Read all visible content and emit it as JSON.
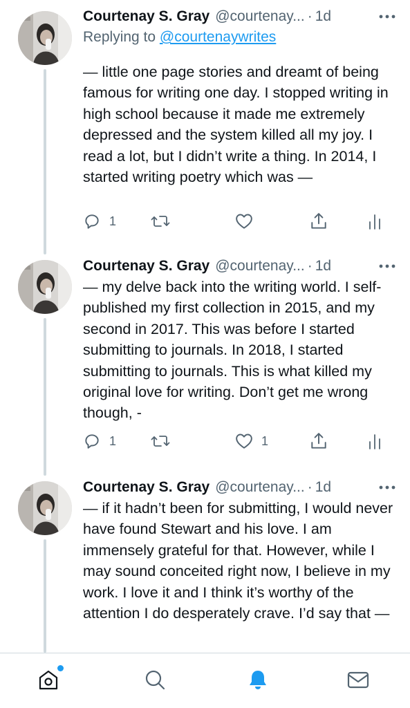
{
  "tweets": [
    {
      "name": "Courtenay S. Gray",
      "handle": "@courtenay...",
      "dot": "·",
      "time": "1d",
      "reply_prefix": "Replying to",
      "reply_handle": "@courtenaywrites",
      "text": "— little one page stories and dreamt of being famous for writing one day. I stopped writing in high school because it made me extremely depressed and the system killed all my joy. I read a lot, but I didn’t write a thing. In 2014, I started writing poetry which was —",
      "reply_count": "1",
      "retweet_count": "",
      "like_count": ""
    },
    {
      "name": "Courtenay S. Gray",
      "handle": "@courtenay...",
      "dot": "·",
      "time": "1d",
      "text": "— my delve back into the writing world. I self-published my first collection in 2015, and my second in 2017. This was before I started submitting to journals. In 2018, I started submitting to journals. This is what killed my original love for writing. Don’t get me wrong though, -",
      "reply_count": "1",
      "retweet_count": "",
      "like_count": "1"
    },
    {
      "name": "Courtenay S. Gray",
      "handle": "@courtenay...",
      "dot": "·",
      "time": "1d",
      "text": "— if it hadn’t been for submitting, I would never have found Stewart and his love. I am immensely grateful for that. However, while I may sound conceited right now, I believe in my work. I love it and I think it’s worthy of the attention I do desperately crave. I’d say that —"
    }
  ],
  "icons": {
    "more": "more-horizontal-icon",
    "reply": "reply-bubble-icon",
    "retweet": "retweet-icon",
    "like": "heart-icon",
    "share": "share-icon",
    "analytics": "analytics-icon",
    "home": "home-icon",
    "search": "search-icon",
    "notifications": "bell-icon",
    "messages": "mail-icon"
  },
  "colors": {
    "accent": "#1d9bf0",
    "text": "#0f1419",
    "muted": "#536471",
    "thread_line": "#cfd9de"
  }
}
